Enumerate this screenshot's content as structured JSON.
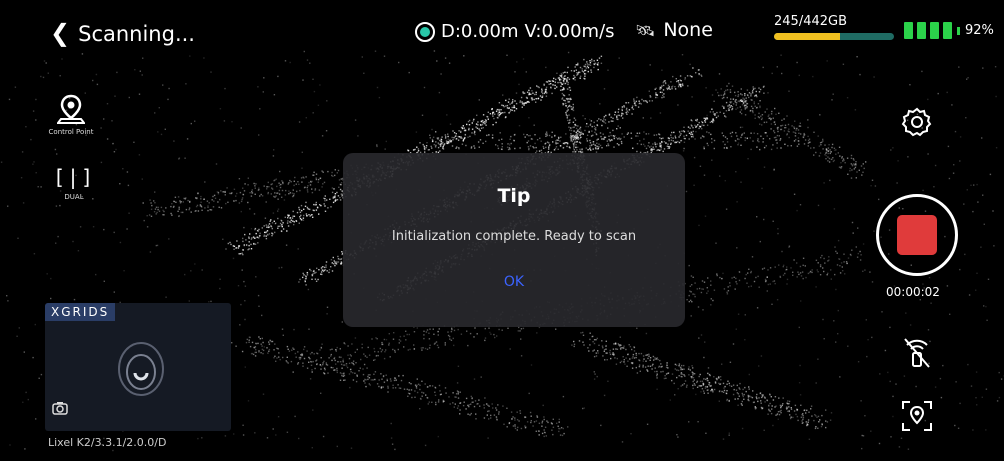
{
  "header": {
    "back_label": "Scanning...",
    "distance": "D:0.00m",
    "velocity": "V:0.00m/s",
    "satellite_status": "None",
    "storage_text": "245/442GB",
    "storage_used_fraction": 0.554,
    "battery_percent": "92%"
  },
  "left_tools": {
    "control_point_label": "Control Point",
    "dual_label": "DUAL"
  },
  "preview": {
    "brand": "XGRIDS",
    "device_label": "Lixel K2/3.3.1/2.0.0/D"
  },
  "right_tools": {
    "timer": "00:00:02"
  },
  "dialog": {
    "title": "Tip",
    "message": "Initialization complete. Ready to scan",
    "ok_label": "OK"
  },
  "colors": {
    "record_red": "#e03b3b",
    "battery_green": "#2bd24a",
    "storage_fill": "#f0c020",
    "link_blue": "#3b63ff",
    "gps_teal": "#28c7a8"
  },
  "icons": [
    "chevron-left-icon",
    "record-dot-icon",
    "satellite-icon",
    "map-pin-icon",
    "dual-bracket-icon",
    "camera-icon",
    "gear-icon",
    "stop-icon",
    "no-signal-icon",
    "locate-icon"
  ]
}
